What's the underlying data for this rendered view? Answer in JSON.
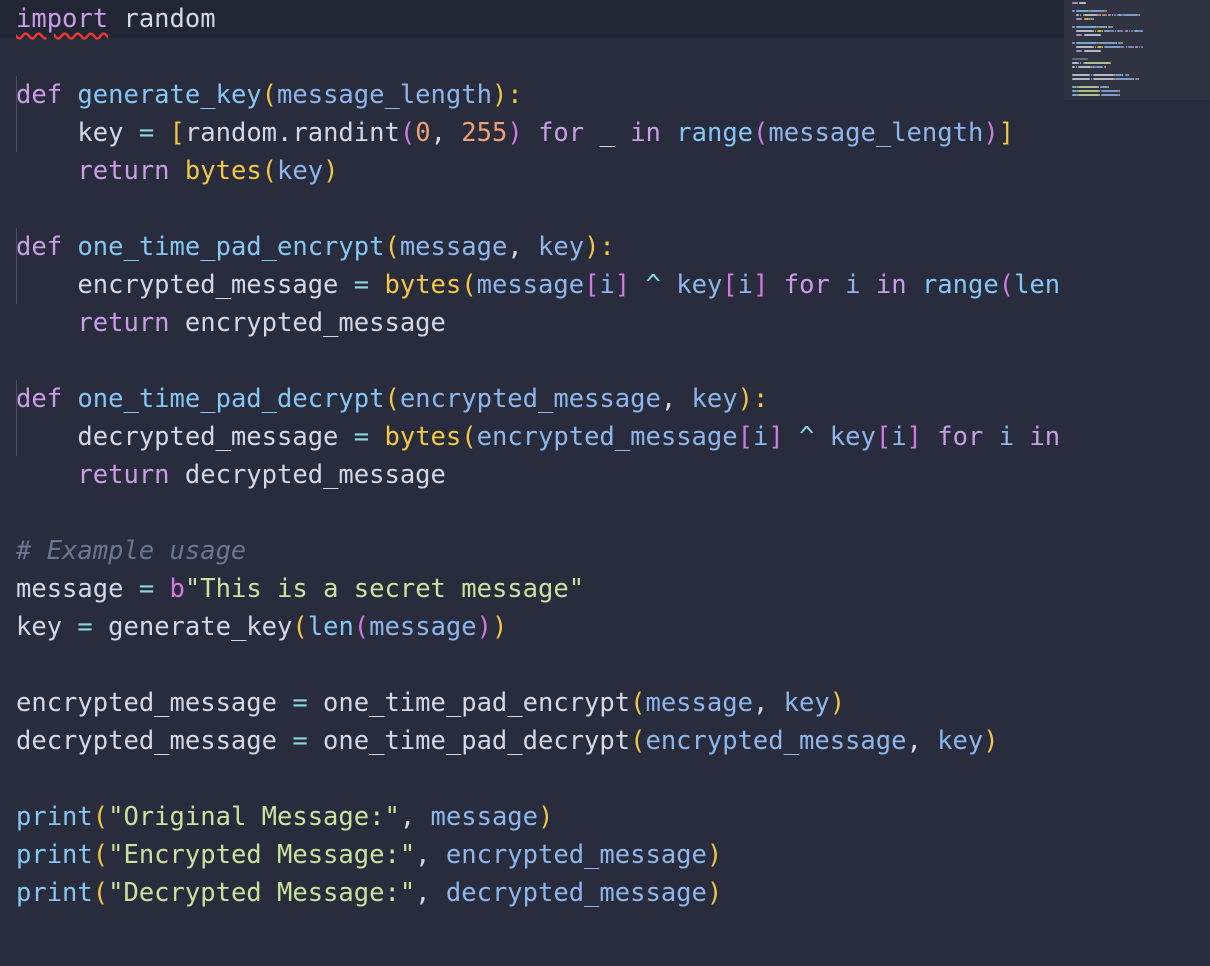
{
  "colors": {
    "background": "#282c3c",
    "current_line": "#222533",
    "keyword": "#c99ee6",
    "function": "#86c6f2",
    "parameter": "#8fb6ea",
    "bracket_1": "#f2c744",
    "bracket_2": "#d07be0",
    "bracket_3": "#4fb3ef",
    "number": "#f09f76",
    "string": "#c9e29e",
    "comment": "#6d7591",
    "operator": "#8fd6e3",
    "text": "#d3d7e6",
    "error_squiggle": "#e53935"
  },
  "editor": {
    "error_marker_icon": "squiggly-underline-icon",
    "lines": [
      [
        {
          "t": "import",
          "c": "imp"
        },
        {
          "t": " random",
          "c": "var"
        }
      ],
      [],
      [
        {
          "t": "def",
          "c": "kw"
        },
        {
          "t": " ",
          "c": "var"
        },
        {
          "t": "generate_key",
          "c": "fn"
        },
        {
          "t": "(",
          "c": "b1"
        },
        {
          "t": "message_length",
          "c": "par"
        },
        {
          "t": "):",
          "c": "b1"
        }
      ],
      [
        {
          "t": "    key ",
          "c": "var"
        },
        {
          "t": "=",
          "c": "op"
        },
        {
          "t": " ",
          "c": "var"
        },
        {
          "t": "[",
          "c": "b1"
        },
        {
          "t": "random.randint",
          "c": "var"
        },
        {
          "t": "(",
          "c": "b2"
        },
        {
          "t": "0",
          "c": "num"
        },
        {
          "t": ", ",
          "c": "var"
        },
        {
          "t": "255",
          "c": "num"
        },
        {
          "t": ")",
          "c": "b2"
        },
        {
          "t": " ",
          "c": "var"
        },
        {
          "t": "for",
          "c": "kw"
        },
        {
          "t": " _ ",
          "c": "var"
        },
        {
          "t": "in",
          "c": "kw"
        },
        {
          "t": " ",
          "c": "var"
        },
        {
          "t": "range",
          "c": "fn"
        },
        {
          "t": "(",
          "c": "b2"
        },
        {
          "t": "message_length",
          "c": "par"
        },
        {
          "t": ")",
          "c": "b2"
        },
        {
          "t": "]",
          "c": "b1"
        }
      ],
      [
        {
          "t": "    ",
          "c": "var"
        },
        {
          "t": "return",
          "c": "kw"
        },
        {
          "t": " ",
          "c": "var"
        },
        {
          "t": "bytes",
          "c": "b1"
        },
        {
          "t": "(",
          "c": "b1"
        },
        {
          "t": "key",
          "c": "par"
        },
        {
          "t": ")",
          "c": "b1"
        }
      ],
      [],
      [
        {
          "t": "def",
          "c": "kw"
        },
        {
          "t": " ",
          "c": "var"
        },
        {
          "t": "one_time_pad_encrypt",
          "c": "fn"
        },
        {
          "t": "(",
          "c": "b1"
        },
        {
          "t": "message",
          "c": "par"
        },
        {
          "t": ", ",
          "c": "var"
        },
        {
          "t": "key",
          "c": "par"
        },
        {
          "t": "):",
          "c": "b1"
        }
      ],
      [
        {
          "t": "    encrypted_message ",
          "c": "var"
        },
        {
          "t": "=",
          "c": "op"
        },
        {
          "t": " ",
          "c": "var"
        },
        {
          "t": "bytes",
          "c": "b1"
        },
        {
          "t": "(",
          "c": "b1"
        },
        {
          "t": "message",
          "c": "par"
        },
        {
          "t": "[",
          "c": "b2"
        },
        {
          "t": "i",
          "c": "par"
        },
        {
          "t": "]",
          "c": "b2"
        },
        {
          "t": " ",
          "c": "var"
        },
        {
          "t": "^",
          "c": "op"
        },
        {
          "t": " ",
          "c": "var"
        },
        {
          "t": "key",
          "c": "par"
        },
        {
          "t": "[",
          "c": "b2"
        },
        {
          "t": "i",
          "c": "par"
        },
        {
          "t": "]",
          "c": "b2"
        },
        {
          "t": " ",
          "c": "var"
        },
        {
          "t": "for",
          "c": "kw"
        },
        {
          "t": " ",
          "c": "var"
        },
        {
          "t": "i",
          "c": "par"
        },
        {
          "t": " ",
          "c": "var"
        },
        {
          "t": "in",
          "c": "kw"
        },
        {
          "t": " ",
          "c": "var"
        },
        {
          "t": "range",
          "c": "fn"
        },
        {
          "t": "(",
          "c": "b2"
        },
        {
          "t": "len",
          "c": "fn"
        }
      ],
      [
        {
          "t": "    ",
          "c": "var"
        },
        {
          "t": "return",
          "c": "kw"
        },
        {
          "t": " encrypted_message",
          "c": "var"
        }
      ],
      [],
      [
        {
          "t": "def",
          "c": "kw"
        },
        {
          "t": " ",
          "c": "var"
        },
        {
          "t": "one_time_pad_decrypt",
          "c": "fn"
        },
        {
          "t": "(",
          "c": "b1"
        },
        {
          "t": "encrypted_message",
          "c": "par"
        },
        {
          "t": ", ",
          "c": "var"
        },
        {
          "t": "key",
          "c": "par"
        },
        {
          "t": "):",
          "c": "b1"
        }
      ],
      [
        {
          "t": "    decrypted_message ",
          "c": "var"
        },
        {
          "t": "=",
          "c": "op"
        },
        {
          "t": " ",
          "c": "var"
        },
        {
          "t": "bytes",
          "c": "b1"
        },
        {
          "t": "(",
          "c": "b1"
        },
        {
          "t": "encrypted_message",
          "c": "par"
        },
        {
          "t": "[",
          "c": "b2"
        },
        {
          "t": "i",
          "c": "par"
        },
        {
          "t": "]",
          "c": "b2"
        },
        {
          "t": " ",
          "c": "var"
        },
        {
          "t": "^",
          "c": "op"
        },
        {
          "t": " ",
          "c": "var"
        },
        {
          "t": "key",
          "c": "par"
        },
        {
          "t": "[",
          "c": "b2"
        },
        {
          "t": "i",
          "c": "par"
        },
        {
          "t": "]",
          "c": "b2"
        },
        {
          "t": " ",
          "c": "var"
        },
        {
          "t": "for",
          "c": "kw"
        },
        {
          "t": " ",
          "c": "var"
        },
        {
          "t": "i",
          "c": "par"
        },
        {
          "t": " ",
          "c": "var"
        },
        {
          "t": "in",
          "c": "kw"
        }
      ],
      [
        {
          "t": "    ",
          "c": "var"
        },
        {
          "t": "return",
          "c": "kw"
        },
        {
          "t": " decrypted_message",
          "c": "var"
        }
      ],
      [],
      [
        {
          "t": "# Example usage",
          "c": "cmt"
        }
      ],
      [
        {
          "t": "message ",
          "c": "var"
        },
        {
          "t": "=",
          "c": "op"
        },
        {
          "t": " ",
          "c": "var"
        },
        {
          "t": "b",
          "c": "b2"
        },
        {
          "t": "\"This is a secret message\"",
          "c": "str"
        }
      ],
      [
        {
          "t": "key ",
          "c": "var"
        },
        {
          "t": "=",
          "c": "op"
        },
        {
          "t": " generate_key",
          "c": "var"
        },
        {
          "t": "(",
          "c": "b1"
        },
        {
          "t": "len",
          "c": "fn"
        },
        {
          "t": "(",
          "c": "b2"
        },
        {
          "t": "message",
          "c": "par"
        },
        {
          "t": ")",
          "c": "b2"
        },
        {
          "t": ")",
          "c": "b1"
        }
      ],
      [],
      [
        {
          "t": "encrypted_message ",
          "c": "var"
        },
        {
          "t": "=",
          "c": "op"
        },
        {
          "t": " one_time_pad_encrypt",
          "c": "var"
        },
        {
          "t": "(",
          "c": "b1"
        },
        {
          "t": "message",
          "c": "par"
        },
        {
          "t": ", ",
          "c": "var"
        },
        {
          "t": "key",
          "c": "par"
        },
        {
          "t": ")",
          "c": "b1"
        }
      ],
      [
        {
          "t": "decrypted_message ",
          "c": "var"
        },
        {
          "t": "=",
          "c": "op"
        },
        {
          "t": " one_time_pad_decrypt",
          "c": "var"
        },
        {
          "t": "(",
          "c": "b1"
        },
        {
          "t": "encrypted_message",
          "c": "par"
        },
        {
          "t": ", ",
          "c": "var"
        },
        {
          "t": "key",
          "c": "par"
        },
        {
          "t": ")",
          "c": "b1"
        }
      ],
      [],
      [
        {
          "t": "print",
          "c": "fn"
        },
        {
          "t": "(",
          "c": "b1"
        },
        {
          "t": "\"Original Message:\"",
          "c": "str"
        },
        {
          "t": ", ",
          "c": "var"
        },
        {
          "t": "message",
          "c": "par"
        },
        {
          "t": ")",
          "c": "b1"
        }
      ],
      [
        {
          "t": "print",
          "c": "fn"
        },
        {
          "t": "(",
          "c": "b1"
        },
        {
          "t": "\"Encrypted Message:\"",
          "c": "str"
        },
        {
          "t": ", ",
          "c": "var"
        },
        {
          "t": "encrypted_message",
          "c": "par"
        },
        {
          "t": ")",
          "c": "b1"
        }
      ],
      [
        {
          "t": "print",
          "c": "fn"
        },
        {
          "t": "(",
          "c": "b1"
        },
        {
          "t": "\"Decrypted Message:\"",
          "c": "str"
        },
        {
          "t": ", ",
          "c": "var"
        },
        {
          "t": "decrypted_message",
          "c": "par"
        },
        {
          "t": ")",
          "c": "b1"
        }
      ]
    ]
  },
  "minimap": {
    "label": "minimap"
  }
}
